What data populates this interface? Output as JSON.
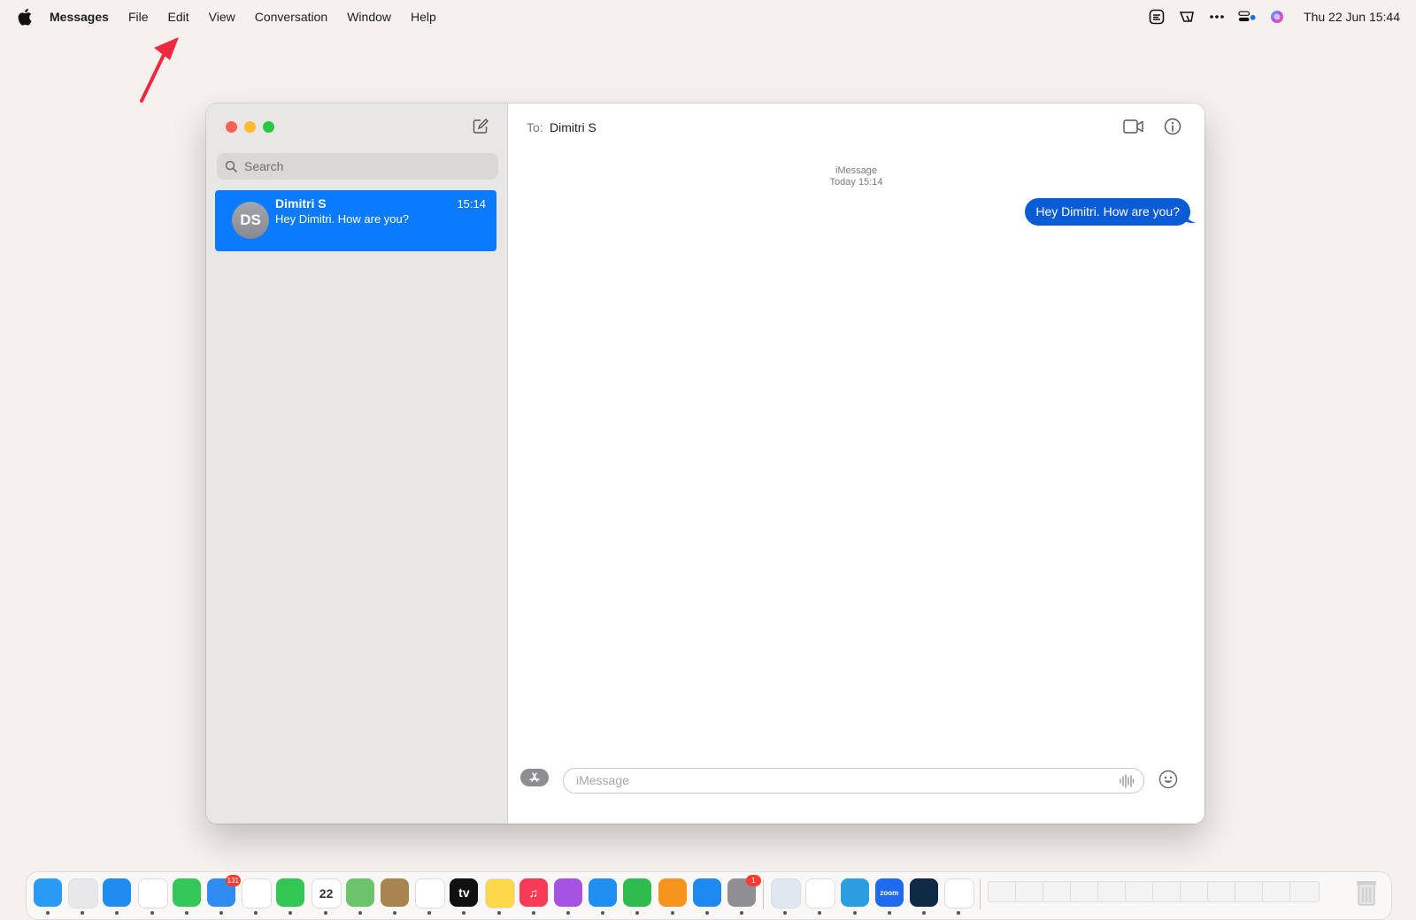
{
  "menubar": {
    "app_name": "Messages",
    "menus": [
      "File",
      "Edit",
      "View",
      "Conversation",
      "Window",
      "Help"
    ],
    "status_icons": [
      "reader-icon",
      "stage-manager-icon",
      "more-icon",
      "control-center-icon",
      "siri-icon"
    ],
    "clock": "Thu 22 Jun  15:44"
  },
  "window": {
    "search_placeholder": "Search",
    "conversation": {
      "initials": "DS",
      "name": "Dimitri S",
      "time": "15:14",
      "preview": "Hey Dimitri. How are you?"
    },
    "header": {
      "to_label": "To:",
      "recipient": "Dimitri S"
    },
    "thread": {
      "service": "iMessage",
      "timestamp": "Today 15:14",
      "message": "Hey Dimitri. How are you?"
    },
    "input_placeholder": "iMessage"
  },
  "dock": {
    "apps": [
      {
        "name": "finder",
        "color": "#2a9bf5",
        "label": ""
      },
      {
        "name": "launchpad",
        "color": "#e8e8ea",
        "label": ""
      },
      {
        "name": "safari",
        "color": "#1f8cf2",
        "label": ""
      },
      {
        "name": "chrome",
        "color": "#ffffff",
        "label": ""
      },
      {
        "name": "messages",
        "color": "#34c759",
        "label": ""
      },
      {
        "name": "mail",
        "color": "#2f8df2",
        "label": "",
        "badge": "131"
      },
      {
        "name": "photos",
        "color": "#ffffff",
        "label": ""
      },
      {
        "name": "facetime",
        "color": "#33c653",
        "label": ""
      },
      {
        "name": "calendar",
        "color": "#ffffff",
        "label": "22"
      },
      {
        "name": "maps",
        "color": "#6cc46a",
        "label": ""
      },
      {
        "name": "contacts",
        "color": "#a8844f",
        "label": ""
      },
      {
        "name": "reminders",
        "color": "#ffffff",
        "label": ""
      },
      {
        "name": "apple-tv",
        "color": "#111111",
        "label": "tv"
      },
      {
        "name": "notes",
        "color": "#fcd84a",
        "label": ""
      },
      {
        "name": "music",
        "color": "#fb3a55",
        "label": "♫"
      },
      {
        "name": "podcasts",
        "color": "#a553e0",
        "label": ""
      },
      {
        "name": "keynote",
        "color": "#1f8ff3",
        "label": ""
      },
      {
        "name": "numbers",
        "color": "#2dbd4f",
        "label": ""
      },
      {
        "name": "pages",
        "color": "#f7941d",
        "label": ""
      },
      {
        "name": "app-store",
        "color": "#1d8af2",
        "label": ""
      },
      {
        "name": "system-settings",
        "color": "#8e8e93",
        "label": "",
        "badge": "1"
      },
      {
        "name": "preview",
        "color": "#dfe8f1",
        "label": ""
      },
      {
        "name": "slack",
        "color": "#ffffff",
        "label": ""
      },
      {
        "name": "telegram",
        "color": "#2a9ee0",
        "label": ""
      },
      {
        "name": "zoom",
        "color": "#1f6bf0",
        "label": "zoom"
      },
      {
        "name": "screen-recorder",
        "color": "#0e2a44",
        "label": ""
      },
      {
        "name": "craft",
        "color": "#ffffff",
        "label": ""
      }
    ],
    "window_thumbnails": 12
  },
  "colors": {
    "accent_blue": "#0a7aff",
    "bubble_blue": "#0a5bd6",
    "annotation_red": "#f0293e"
  }
}
